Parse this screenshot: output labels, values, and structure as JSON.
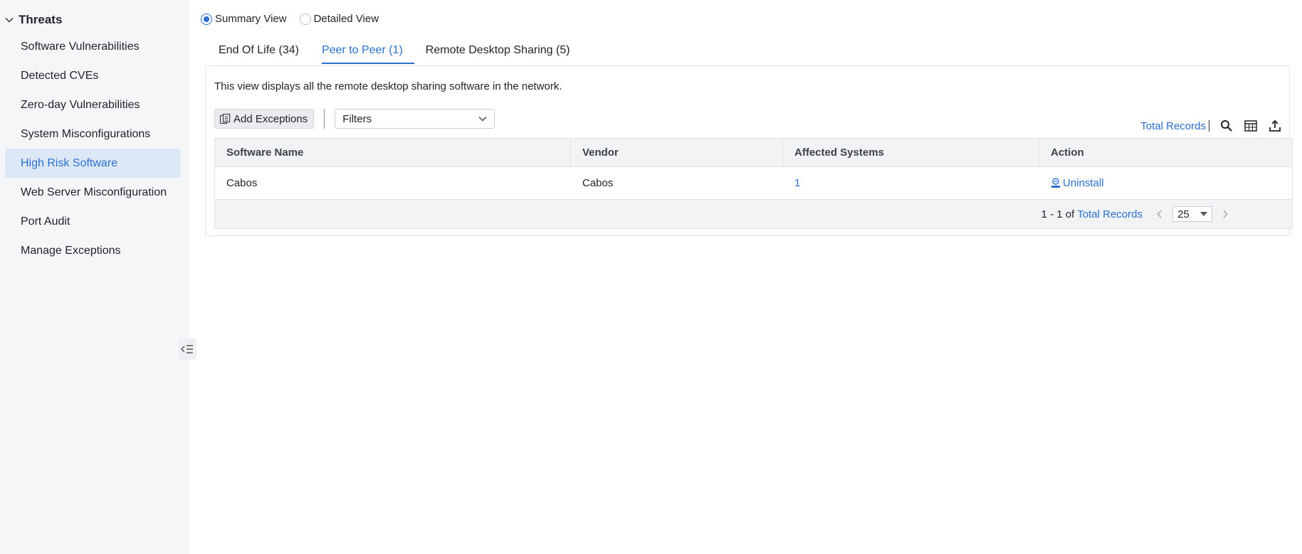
{
  "sidebar": {
    "section_title": "Threats",
    "items": [
      {
        "label": "Software Vulnerabilities"
      },
      {
        "label": "Detected CVEs"
      },
      {
        "label": "Zero-day Vulnerabilities"
      },
      {
        "label": "System Misconfigurations"
      },
      {
        "label": "High Risk Software",
        "active": true
      },
      {
        "label": "Web Server Misconfiguration"
      },
      {
        "label": "Port Audit"
      },
      {
        "label": "Manage Exceptions"
      }
    ]
  },
  "view_toggle": {
    "summary_label": "Summary View",
    "detailed_label": "Detailed View",
    "selected": "Summary View"
  },
  "tabs": [
    {
      "label": "End Of Life (34)"
    },
    {
      "label": "Peer to Peer (1)",
      "active": true
    },
    {
      "label": "Remote Desktop Sharing (5)"
    }
  ],
  "panel": {
    "description": "This view displays all the remote desktop sharing software in the network."
  },
  "toolbar": {
    "add_exceptions_label": "Add Exceptions",
    "filters_label": "Filters",
    "total_records_label": "Total Records"
  },
  "table": {
    "columns": [
      "Software Name",
      "Vendor",
      "Affected Systems",
      "Action"
    ],
    "rows": [
      {
        "software_name": "Cabos",
        "vendor": "Cabos",
        "affected_systems": "1",
        "action": "Uninstall"
      }
    ],
    "footer": {
      "range_text": "1 - 1 of",
      "total_records_label": "Total Records",
      "per_page": "25"
    }
  },
  "colors": {
    "accent": "#2b6fcf",
    "sidebar_bg": "#f5f6f8",
    "active_item_bg": "#dde8f6"
  },
  "icons": [
    "chevron-down-icon",
    "collapse-sidebar-icon",
    "add-exceptions-icon",
    "search-icon",
    "column-chooser-icon",
    "export-icon",
    "uninstall-icon",
    "chevron-left-icon",
    "chevron-right-icon",
    "caret-down-icon"
  ]
}
